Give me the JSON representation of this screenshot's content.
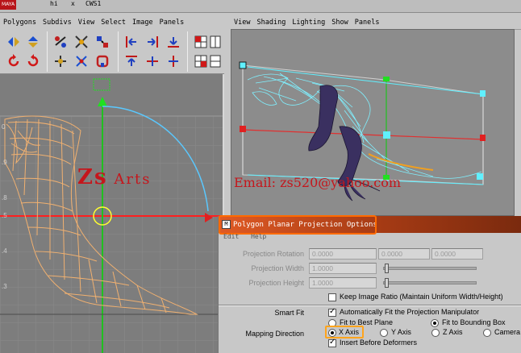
{
  "top_strip": {
    "logo": "MAYA",
    "selection": [
      "hi",
      "x",
      "CWS1"
    ]
  },
  "left_menubar": [
    "Polygons",
    "Subdivs",
    "View",
    "Select",
    "Image",
    "Panels"
  ],
  "right_menubar": [
    "View",
    "Shading",
    "Lighting",
    "Show",
    "Panels"
  ],
  "watermark": {
    "left_big": "Zs",
    "left_rest": "Arts",
    "email": "Email:  zs520@yahoo.com"
  },
  "dialog": {
    "title": "Polygon Planar Projection Options",
    "menu": [
      "Edit",
      "Help"
    ],
    "projection_rotation": {
      "label": "Projection Rotation",
      "values": [
        "0.0000",
        "0.0000",
        "0.0000"
      ]
    },
    "projection_width": {
      "label": "Projection Width",
      "value": "1.0000"
    },
    "projection_height": {
      "label": "Projection Height",
      "value": "1.0000"
    },
    "keep_ratio": {
      "label": "Keep Image Ratio (Maintain Uniform Width/Height)",
      "checked": false
    },
    "smart_fit": {
      "label": "Smart Fit",
      "option": "Automatically Fit the Projection Manipulator",
      "checked": true
    },
    "fit_options": [
      "Fit to Best Plane",
      "Fit to Bounding Box"
    ],
    "fit_selected": "Fit to Bounding Box",
    "mapping_direction": {
      "label": "Mapping Direction",
      "options": [
        "X Axis",
        "Y Axis",
        "Z Axis",
        "Camera"
      ],
      "selected": "X Axis"
    },
    "insert_before_deformers": {
      "label": "Insert Before Deformers",
      "checked": true
    }
  },
  "colors": {
    "title_gradient_start": "#e05a24",
    "highlight": "#ff6a00",
    "mesh": "#f0b070",
    "wire_cyan": "#7ff0ff",
    "manip_red": "#e02020",
    "manip_green": "#10e020"
  }
}
